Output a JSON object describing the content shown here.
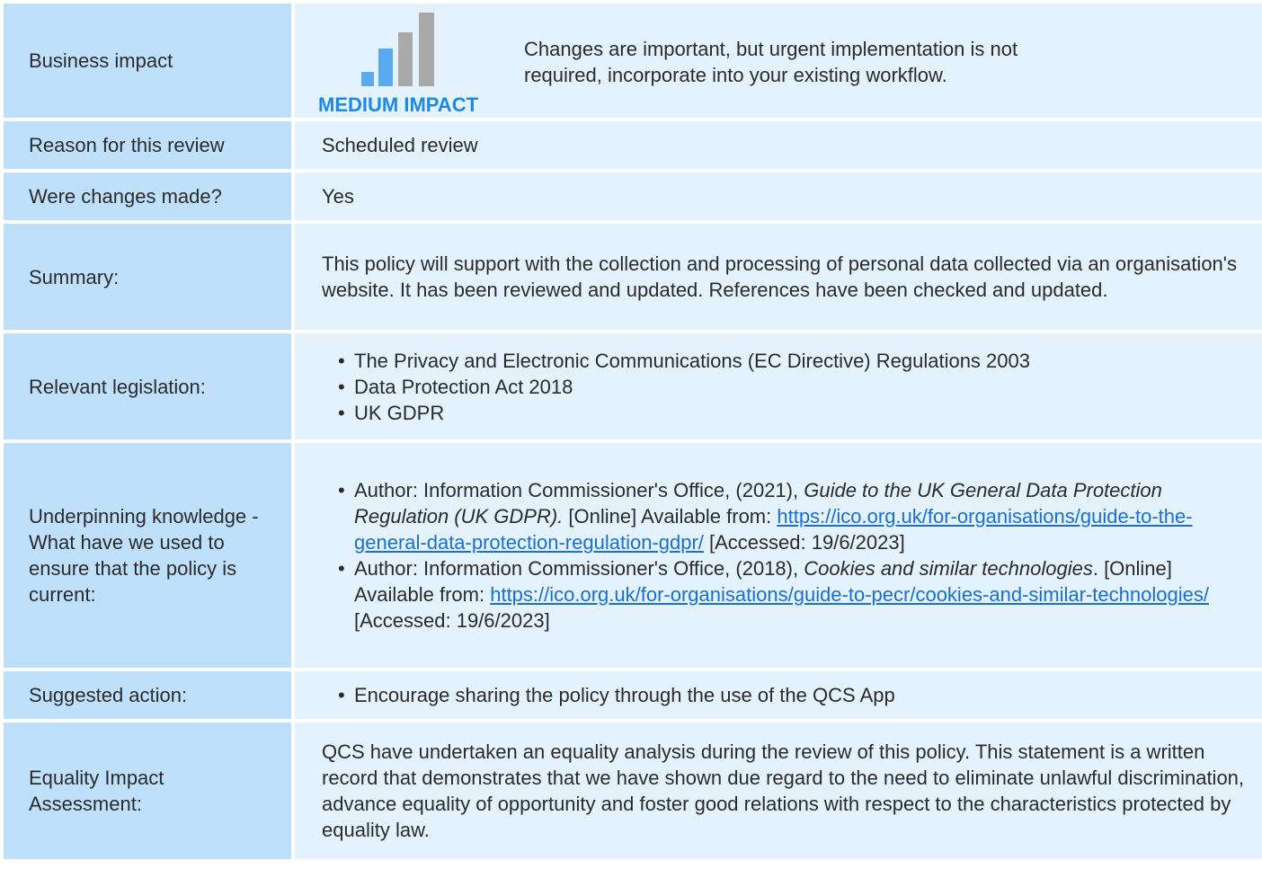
{
  "colors": {
    "label_bg": "#bfe0fb",
    "value_bg": "#e3f2fd",
    "accent": "#1e88e5",
    "bar_light": "#5aaaf0",
    "bar_gray": "#a9a9a9"
  },
  "impact": {
    "label": "Business impact",
    "badge": "MEDIUM IMPACT",
    "level": "2 of 4",
    "text": "Changes are important, but urgent implementation is not required, incorporate into your existing workflow."
  },
  "reason": {
    "label": "Reason for this review",
    "value": "Scheduled review"
  },
  "changes": {
    "label": "Were changes made?",
    "value": "Yes"
  },
  "summary": {
    "label": "Summary:",
    "value": "This policy will support with the collection and processing of personal data collected via an organisation's website. It has been reviewed and updated. References have been checked and updated."
  },
  "legislation": {
    "label": "Relevant legislation:",
    "items": [
      "The Privacy and Electronic Communications (EC Directive) Regulations 2003",
      "Data Protection Act 2018",
      "UK GDPR"
    ]
  },
  "knowledge": {
    "label": "Underpinning knowledge - What have we used to ensure that the policy is current:",
    "refs": [
      {
        "prefix": "Author: Information Commissioner's Office, (2021), ",
        "title": "Guide to the UK General Data Protection Regulation (UK GDPR).",
        "middle": " [Online] Available from: ",
        "link": "https://ico.org.uk/for-organisations/guide-to-the-general-data-protection-regulation-gdpr/",
        "suffix": " [Accessed: 19/6/2023]"
      },
      {
        "prefix": "Author: Information Commissioner's Office, (2018), ",
        "title": "Cookies and similar technologies",
        "middle": ". [Online] Available from: ",
        "link": "https://ico.org.uk/for-organisations/guide-to-pecr/cookies-and-similar-technologies/",
        "suffix": " [Accessed: 19/6/2023]"
      }
    ]
  },
  "action": {
    "label": "Suggested action:",
    "items": [
      "Encourage sharing the policy through the use of the QCS App"
    ]
  },
  "equality": {
    "label": "Equality Impact Assessment:",
    "value": "QCS have undertaken an equality analysis during the review of this policy. This statement is a written record that demonstrates that we have shown due regard to the need to eliminate unlawful discrimination, advance equality of opportunity and foster good relations with respect to the characteristics protected by equality law."
  }
}
